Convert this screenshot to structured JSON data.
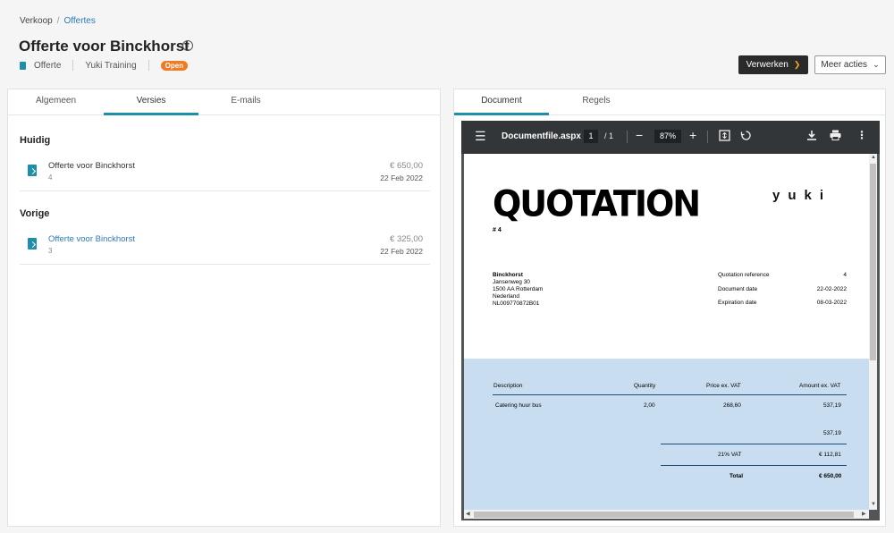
{
  "breadcrumb": {
    "root": "Verkoop",
    "current": "Offertes"
  },
  "page": {
    "title": "Offerte voor Binckhorst"
  },
  "meta": {
    "type": "Offerte",
    "company": "Yuki Training",
    "status": "Open"
  },
  "actions": {
    "process": "Verwerken",
    "more": "Meer acties"
  },
  "left_tabs": [
    {
      "label": "Algemeen"
    },
    {
      "label": "Versies"
    },
    {
      "label": "E-mails"
    }
  ],
  "sections": {
    "current": {
      "label": "Huidig",
      "item": {
        "name": "Offerte voor Binckhorst",
        "number": "4",
        "amount": "€ 650,00",
        "date": "22 Feb 2022"
      }
    },
    "previous": {
      "label": "Vorige",
      "item": {
        "name": "Offerte voor Binckhorst",
        "number": "3",
        "amount": "€ 325,00",
        "date": "22 Feb 2022"
      }
    }
  },
  "right_tabs": [
    {
      "label": "Document"
    },
    {
      "label": "Regels"
    }
  ],
  "viewer": {
    "filename": "Documentfile.aspx",
    "page": "1",
    "page_total": "/ 1",
    "zoom": "87%"
  },
  "document": {
    "heading": "QUOTATION",
    "number": "# 4",
    "logo": "yuki",
    "customer": {
      "name": "Binckhorst",
      "street": "Jansenweg 30",
      "city": "1500 AA Rotterdam",
      "country": "Nederland",
      "vat": "NL009770872B01"
    },
    "meta": [
      {
        "key": "Quotation reference",
        "value": "4"
      },
      {
        "key": "Document date",
        "value": "22-02-2022"
      },
      {
        "key": "Expiration date",
        "value": "08-03-2022"
      }
    ],
    "table": {
      "headers": {
        "description": "Description",
        "quantity": "Quantity",
        "price": "Price ex. VAT",
        "amount": "Amount ex. VAT"
      },
      "row": {
        "description": "Catering huur bus",
        "quantity": "2,00",
        "price": "268,60",
        "amount": "537,19"
      },
      "subtotal": "537,19",
      "vat_label": "21% VAT",
      "vat_amount": "€ 112,81",
      "total_label": "Total",
      "total_amount": "€ 650,00"
    }
  }
}
